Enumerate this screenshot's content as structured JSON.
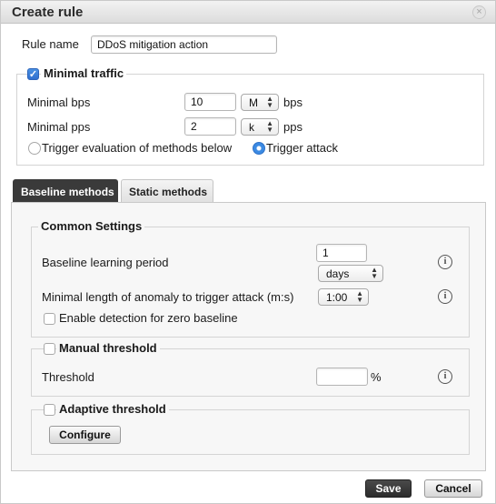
{
  "dialog": {
    "title": "Create rule",
    "close_glyph": "×"
  },
  "rule_name": {
    "label": "Rule name",
    "value": "DDoS mitigation action"
  },
  "minimal_traffic": {
    "legend": "Minimal traffic",
    "enabled": true,
    "bps_label": "Minimal bps",
    "bps_value": "10",
    "bps_unit_select": "M",
    "bps_unit": "bps",
    "pps_label": "Minimal pps",
    "pps_value": "2",
    "pps_unit_select": "k",
    "pps_unit": "pps",
    "radio_evaluate_label": "Trigger evaluation of methods below",
    "radio_attack_label": "Trigger attack",
    "selected_radio": "Trigger attack"
  },
  "tabs": [
    {
      "label": "Baseline methods",
      "active": true
    },
    {
      "label": "Static methods",
      "active": false
    }
  ],
  "common_settings": {
    "legend": "Common Settings",
    "learning_period_label": "Baseline learning period",
    "learning_period_value": "1",
    "learning_period_unit": "days",
    "anomaly_label": "Minimal length of anomaly to trigger attack (m:s)",
    "anomaly_value": "1:00",
    "zero_baseline_label": "Enable detection for zero baseline",
    "zero_baseline_checked": false
  },
  "manual_threshold": {
    "legend": "Manual threshold",
    "checked": false,
    "threshold_label": "Threshold",
    "threshold_value": "",
    "threshold_unit": "%"
  },
  "adaptive_threshold": {
    "legend": "Adaptive threshold",
    "checked": false,
    "configure_label": "Configure"
  },
  "footer": {
    "save_label": "Save",
    "cancel_label": "Cancel"
  },
  "icons": {
    "info_glyph": "i",
    "check_glyph": "✓",
    "select_arrows": "▲▼"
  },
  "colors": {
    "accent": "#3b8ae3",
    "active_tab": "#3a3a3a"
  }
}
